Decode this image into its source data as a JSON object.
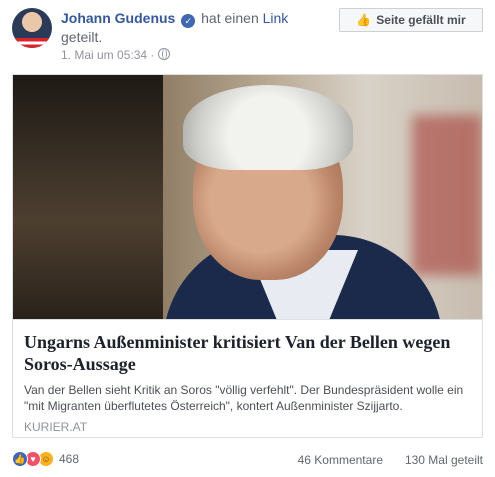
{
  "post": {
    "author": "Johann Gudenus",
    "action_prefix": "hat einen",
    "action_link": "Link",
    "action_suffix": "geteilt.",
    "timestamp": "1. Mai um 05:34",
    "separator": "·",
    "like_page_label": "Seite gefällt mir"
  },
  "link_card": {
    "title": "Ungarns Außenminister kritisiert Van der Bellen wegen Soros-Aussage",
    "description": "Van der Bellen sieht Kritik an Soros \"völlig verfehlt\". Der Bundespräsident wolle ein \"mit Migranten überflutetes Österreich\", kontert Außenminister Szijjarto.",
    "source": "KURIER.AT"
  },
  "footer": {
    "reaction_icons": [
      "like-icon",
      "love-icon",
      "haha-icon"
    ],
    "reaction_count": "468",
    "comments": "46 Kommentare",
    "shares": "130 Mal geteilt"
  },
  "colors": {
    "link_blue": "#365899",
    "like_blue": "#4267b2",
    "love_red": "#f25268",
    "haha_yellow": "#f7b125",
    "meta_gray": "#90949c"
  }
}
